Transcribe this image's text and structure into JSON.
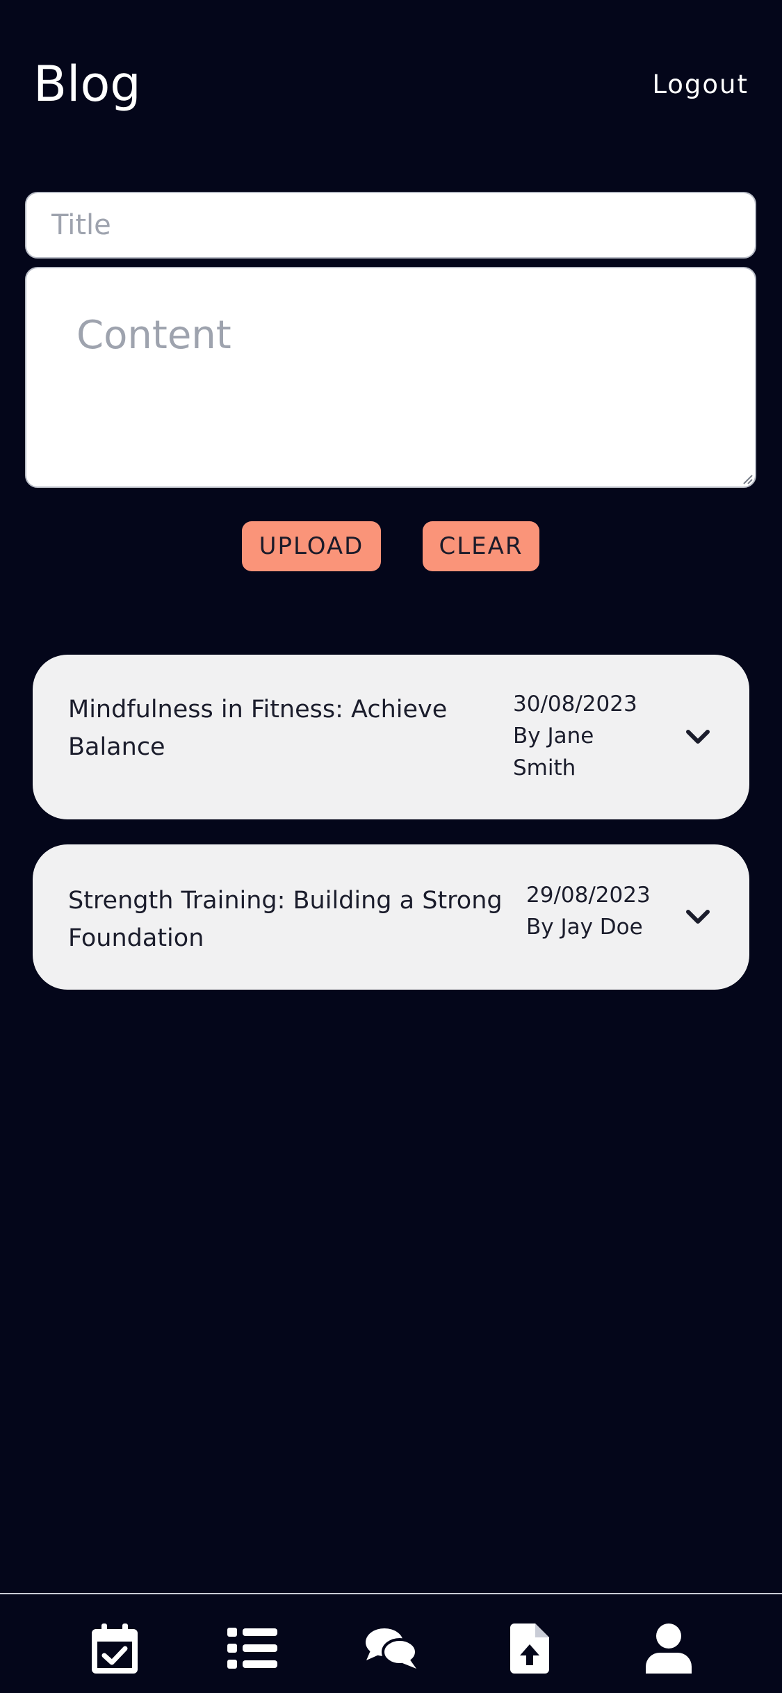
{
  "header": {
    "title": "Blog",
    "logout_label": "Logout"
  },
  "form": {
    "title_placeholder": "Title",
    "title_value": "",
    "content_placeholder": "Content",
    "content_value": "",
    "upload_label": "UPLOAD",
    "clear_label": "CLEAR"
  },
  "posts": [
    {
      "title": "Mindfulness in Fitness: Achieve Balance",
      "date": "30/08/2023",
      "author": "By Jane Smith"
    },
    {
      "title": "Strength Training: Building a Strong Foundation",
      "date": "29/08/2023",
      "author": "By Jay Doe"
    }
  ],
  "bottom_nav": {
    "items": [
      {
        "icon": "calendar-check-icon"
      },
      {
        "icon": "list-icon"
      },
      {
        "icon": "comments-icon"
      },
      {
        "icon": "file-upload-icon"
      },
      {
        "icon": "user-icon"
      }
    ]
  },
  "colors": {
    "background": "#04061a",
    "button": "#fa9479",
    "card": "#f1f1f2",
    "text_light": "#ffffff",
    "text_dark": "#1b1d2c"
  }
}
